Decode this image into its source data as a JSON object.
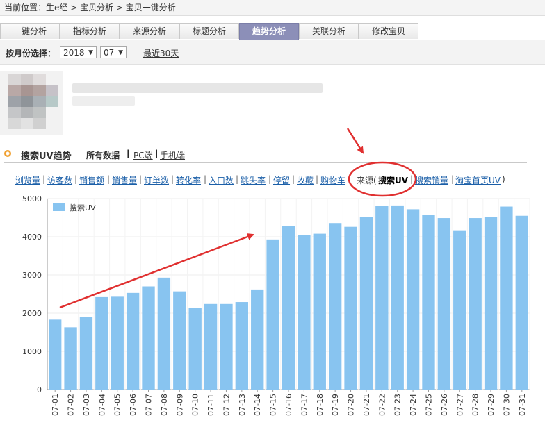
{
  "breadcrumb": "当前位置：生e经 > 宝贝分析 > 宝贝一键分析",
  "tabs": [
    {
      "label": "一键分析",
      "active": false
    },
    {
      "label": "指标分析",
      "active": false
    },
    {
      "label": "来源分析",
      "active": false
    },
    {
      "label": "标题分析",
      "active": false
    },
    {
      "label": "趋势分析",
      "active": true
    },
    {
      "label": "关联分析",
      "active": false
    },
    {
      "label": "修改宝贝",
      "active": false
    }
  ],
  "filter": {
    "label": "按月份选择：",
    "year": "2018",
    "month": "07",
    "recent": "最近30天"
  },
  "section": {
    "title": "搜索UV趋势",
    "all_data": "所有数据",
    "sep": "|",
    "pc": "PC端",
    "mobile": "手机端"
  },
  "metrics": {
    "items": [
      "浏览量",
      "访客数",
      "销售额",
      "销售量",
      "订单数",
      "转化率",
      "入口数",
      "跳失率",
      "停留",
      "收藏",
      "购物车"
    ],
    "source_label": "来源(",
    "source_selected": "搜索UV",
    "source_items": [
      "搜索销量",
      "淘宝首页UV"
    ],
    "close_paren": ")"
  },
  "colors": {
    "bar": "#88c4f0",
    "annotation": "#e03030",
    "tab_active": "#8c8fb8",
    "link": "#1b5fa8"
  },
  "chart_data": {
    "type": "bar",
    "legend": "搜索UV",
    "legend_position": "top-left",
    "grid": true,
    "ylim": [
      0,
      5000
    ],
    "yticks": [
      0,
      1000,
      2000,
      3000,
      4000,
      5000
    ],
    "categories": [
      "07-01",
      "07-02",
      "07-03",
      "07-04",
      "07-05",
      "07-06",
      "07-07",
      "07-08",
      "07-09",
      "07-10",
      "07-11",
      "07-12",
      "07-13",
      "07-14",
      "07-15",
      "07-16",
      "07-17",
      "07-18",
      "07-19",
      "07-20",
      "07-21",
      "07-22",
      "07-23",
      "07-24",
      "07-25",
      "07-26",
      "07-27",
      "07-28",
      "07-29",
      "07-30",
      "07-31"
    ],
    "values": [
      1830,
      1630,
      1900,
      2420,
      2430,
      2530,
      2700,
      2930,
      2570,
      2130,
      2240,
      2240,
      2290,
      2620,
      3930,
      4280,
      4040,
      4080,
      4360,
      4260,
      4510,
      4800,
      4820,
      4720,
      4570,
      4490,
      4170,
      4490,
      4510,
      4790,
      4550
    ]
  }
}
